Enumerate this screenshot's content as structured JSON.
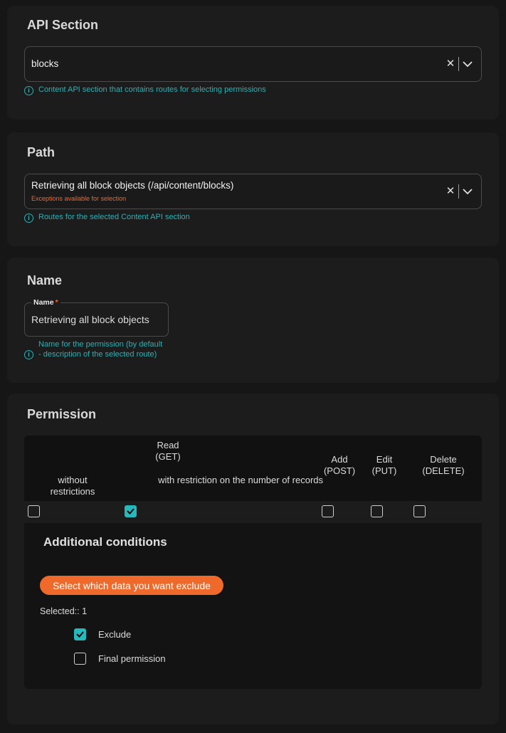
{
  "api_section": {
    "title": "API Section",
    "value": "blocks",
    "hint": "Content API section that contains routes for selecting permissions"
  },
  "path": {
    "title": "Path",
    "value": "Retrieving all block objects (/api/content/blocks)",
    "sub": "Exceptions available for selection",
    "hint": "Routes for the selected Content API section"
  },
  "name": {
    "title": "Name",
    "field_label": "Name",
    "required_mark": "*",
    "value": "Retrieving all block objects",
    "hint": "Name for the permission (by default - description of the selected route)"
  },
  "permission": {
    "title": "Permission",
    "headers": {
      "read": "Read (GET)",
      "without": "without restrictions",
      "with_restriction": "with restriction on the number of records",
      "add": "Add (POST)",
      "edit": "Edit (PUT)",
      "delete": "Delete (DELETE)"
    },
    "checked": {
      "without": false,
      "with_restriction": true,
      "add": false,
      "edit": false,
      "delete": false
    }
  },
  "conditions": {
    "title": "Additional conditions",
    "button": "Select which data you want exclude",
    "selected": "Selected:: 1",
    "options": [
      {
        "label": "Exclude",
        "checked": true
      },
      {
        "label": "Final permission",
        "checked": false
      }
    ]
  },
  "colors": {
    "accent_teal": "#27b8bc",
    "accent_orange": "#ef6a2a",
    "background": "#161616"
  },
  "icons": [
    "info-icon",
    "clear-icon",
    "chevron-down-icon",
    "checkmark-icon"
  ]
}
